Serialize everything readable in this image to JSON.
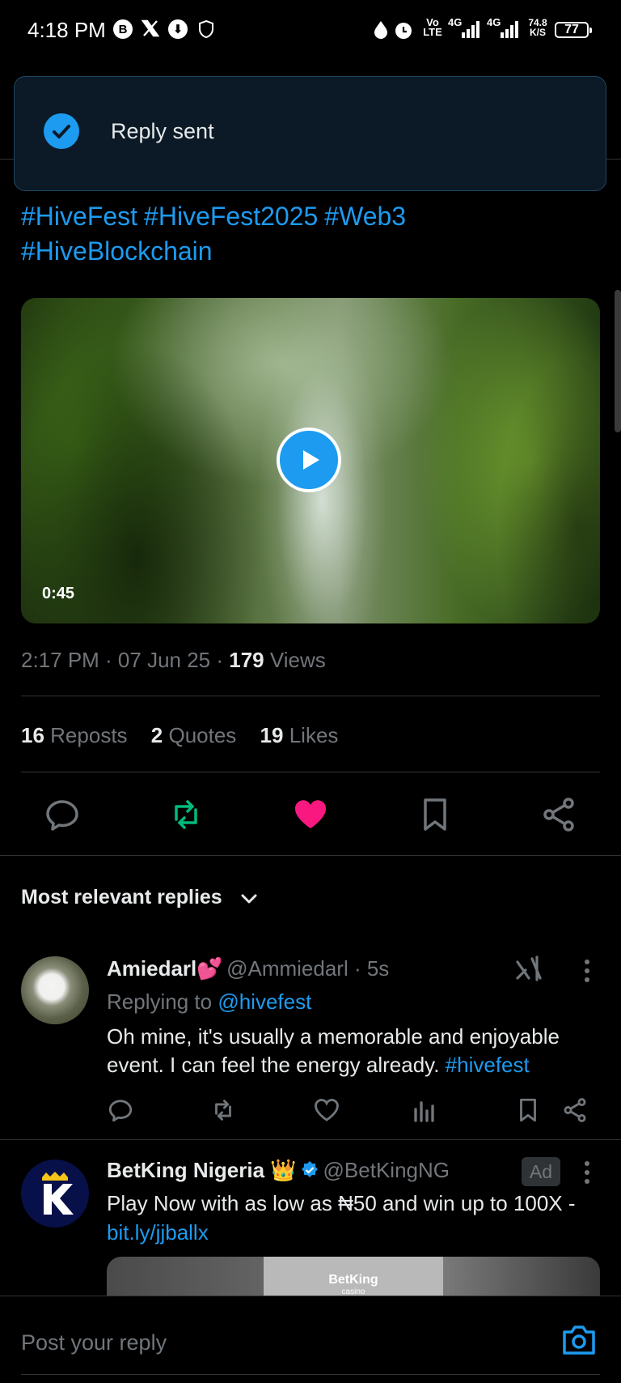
{
  "status_bar": {
    "time": "4:18 PM",
    "network_1": "Vo LTE",
    "network_2": "4G",
    "network_3": "4G",
    "speed": "74.8 K/S",
    "battery": "77"
  },
  "toast": {
    "message": "Reply sent"
  },
  "post": {
    "hashtags": [
      "#HiveFest",
      "#HiveFest2025",
      "#Web3",
      "#HiveBlockchain"
    ],
    "video_duration": "0:45",
    "meta_prefix": "2:17 PM · 07 Jun 25 · ",
    "views_count": "179",
    "views_label": " Views",
    "stats": {
      "reposts_count": "16",
      "reposts_label": "Reposts",
      "quotes_count": "2",
      "quotes_label": "Quotes",
      "likes_count": "19",
      "likes_label": "Likes"
    },
    "liked": true
  },
  "replies_sort": "Most relevant replies",
  "replies": [
    {
      "name": "Amiedarl💕",
      "handle": "@Ammiedarl · 5s",
      "replying_prefix": "Replying to ",
      "replying_to": "@hivefest",
      "text": "Oh mine, it's usually a memorable and enjoyable event. I can feel the energy already. ",
      "tag": "#hivefest"
    },
    {
      "name": "BetKing Nigeria 👑",
      "handle": "@BetKingNG",
      "ad_label": "Ad",
      "text": "Play Now with as low as ₦50 and win up to 100X - ",
      "link": "bit.ly/jjballx",
      "media_logo": "BetKing",
      "media_logo_sub": "casino"
    }
  ],
  "reply_input": {
    "placeholder": "Post your reply"
  },
  "colors": {
    "accent": "#1d9bf0",
    "repost_green": "#00ba7c",
    "like_pink": "#f91880"
  }
}
